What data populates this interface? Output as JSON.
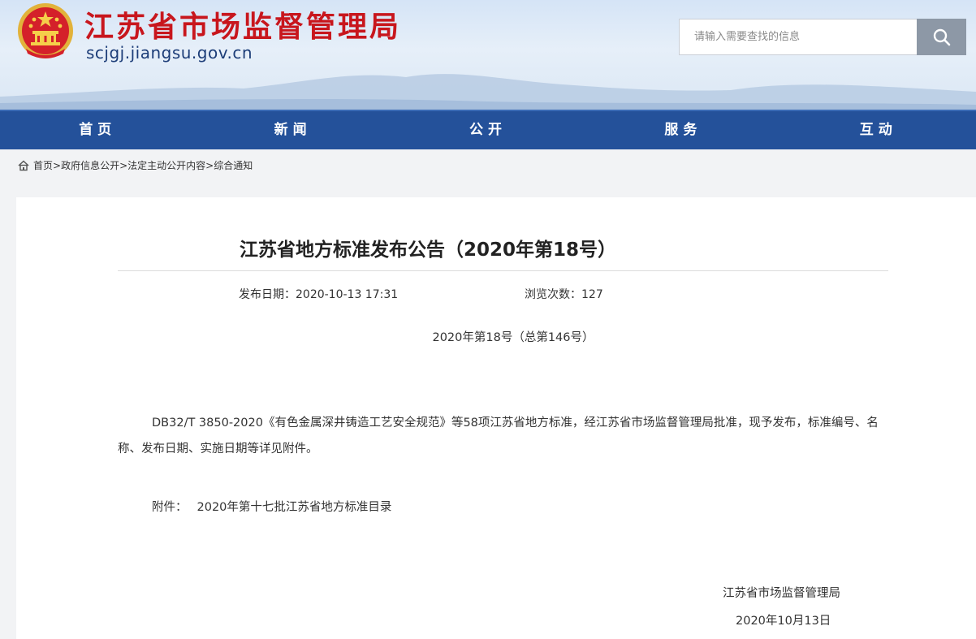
{
  "header": {
    "site_title": "江苏省市场监督管理局",
    "site_url": "scjgj.jiangsu.gov.cn",
    "search_placeholder": "请输入需要查找的信息",
    "emblem_icon": "national-emblem-icon",
    "search_icon": "search-icon"
  },
  "nav": {
    "items": [
      {
        "label": "首页"
      },
      {
        "label": "新闻"
      },
      {
        "label": "公开"
      },
      {
        "label": "服务"
      },
      {
        "label": "互动"
      }
    ]
  },
  "breadcrumb": {
    "home_icon": "home-icon",
    "items": [
      "首页",
      "政府信息公开",
      "法定主动公开内容",
      "综合通知"
    ],
    "separator": ">"
  },
  "article": {
    "title": "江苏省地方标准发布公告（2020年第18号）",
    "publish_label": "发布日期：",
    "publish_date": "2020-10-13 17:31",
    "views_label": "浏览次数：",
    "views": "127",
    "doc_number": "2020年第18号（总第146号）",
    "body": "DB32/T 3850-2020《有色金属深井铸造工艺安全规范》等58项江苏省地方标准，经江苏省市场监督管理局批准，现予发布，标准编号、名称、发布日期、实施日期等详见附件。",
    "attachment_label": "附件：",
    "attachment_link": "2020年第十七批江苏省地方标准目录",
    "signature": "江苏省市场监督管理局",
    "signature_date": "2020年10月13日"
  },
  "colors": {
    "nav_bg": "#24519a",
    "title_red": "#c8161d",
    "url_blue": "#1c3d78",
    "search_button": "#8d98a6"
  }
}
